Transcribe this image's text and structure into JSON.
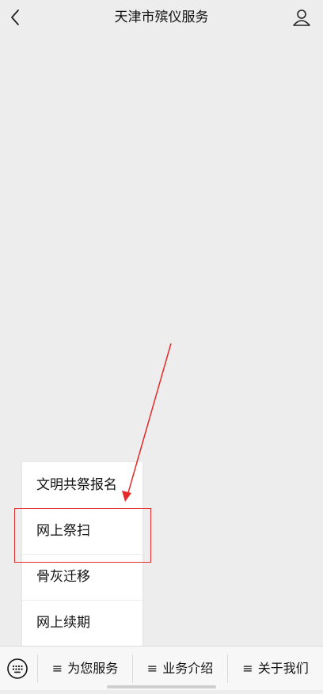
{
  "header": {
    "title": "天津市殡仪服务",
    "back_icon": "chevron-left-icon",
    "user_icon": "user-icon"
  },
  "popup_menu": {
    "items": [
      {
        "label": "文明共祭报名"
      },
      {
        "label": "网上祭扫"
      },
      {
        "label": "骨灰迁移"
      },
      {
        "label": "网上续期"
      }
    ]
  },
  "bottom_bar": {
    "keyboard_icon": "keyboard-icon",
    "menus": [
      {
        "icon": "≡",
        "label": "为您服务"
      },
      {
        "icon": "≡",
        "label": "业务介绍"
      },
      {
        "icon": "≡",
        "label": "关于我们"
      }
    ]
  },
  "annotation": {
    "color": "#e52a2a"
  }
}
